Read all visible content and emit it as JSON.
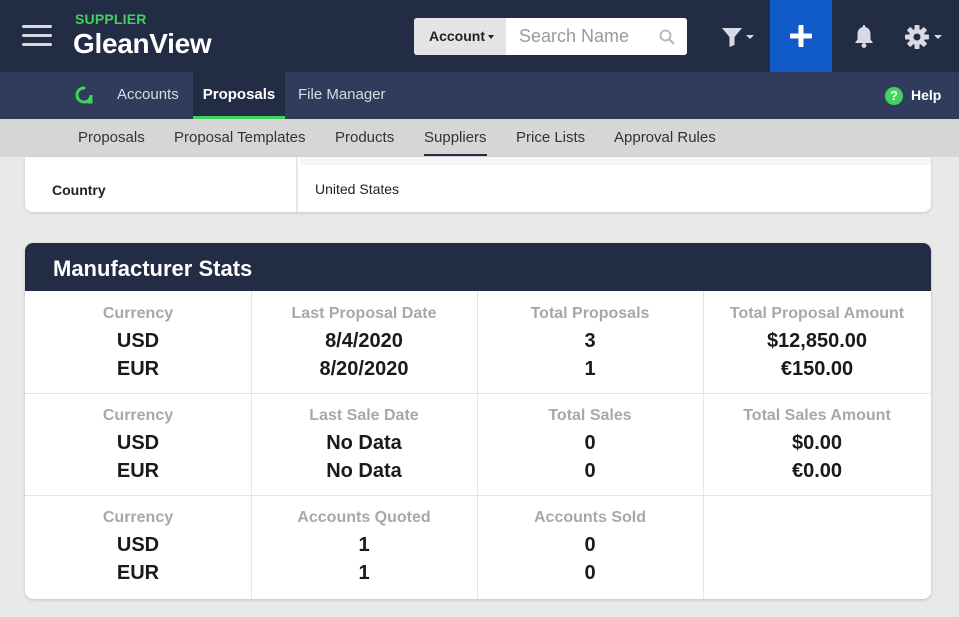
{
  "header": {
    "brand_sub": "SUPPLIER",
    "brand_main": "GleanView",
    "search_type_label": "Account",
    "search_placeholder": "Search Name"
  },
  "nav": {
    "items": [
      {
        "label": "Accounts"
      },
      {
        "label": "Proposals",
        "active": true
      },
      {
        "label": "File Manager"
      }
    ],
    "help_label": "Help"
  },
  "subnav": {
    "items": [
      {
        "label": "Proposals"
      },
      {
        "label": "Proposal Templates"
      },
      {
        "label": "Products"
      },
      {
        "label": "Suppliers",
        "active": true
      },
      {
        "label": "Price Lists"
      },
      {
        "label": "Approval Rules"
      }
    ]
  },
  "country": {
    "label": "Country",
    "value": "United States"
  },
  "stats": {
    "title": "Manufacturer Stats",
    "rows": [
      [
        {
          "label": "Currency",
          "v1": "USD",
          "v2": "EUR"
        },
        {
          "label": "Last Proposal Date",
          "v1": "8/4/2020",
          "v2": "8/20/2020"
        },
        {
          "label": "Total Proposals",
          "v1": "3",
          "v2": "1"
        },
        {
          "label": "Total Proposal Amount",
          "v1": "$12,850.00",
          "v2": "€150.00"
        }
      ],
      [
        {
          "label": "Currency",
          "v1": "USD",
          "v2": "EUR"
        },
        {
          "label": "Last Sale Date",
          "v1": "No Data",
          "v2": "No Data"
        },
        {
          "label": "Total Sales",
          "v1": "0",
          "v2": "0"
        },
        {
          "label": "Total Sales Amount",
          "v1": "$0.00",
          "v2": "€0.00"
        }
      ],
      [
        {
          "label": "Currency",
          "v1": "USD",
          "v2": "EUR"
        },
        {
          "label": "Accounts Quoted",
          "v1": "1",
          "v2": "1"
        },
        {
          "label": "Accounts Sold",
          "v1": "0",
          "v2": "0"
        },
        {
          "label": "",
          "v1": "",
          "v2": ""
        }
      ]
    ]
  },
  "colors": {
    "header_bg": "#232c45",
    "nav_bg": "#313b5c",
    "accent_green": "#3fd25d",
    "add_button_blue": "#0f59c8",
    "subnav_bg": "#d6d6d6"
  },
  "icons": {
    "menu": "hamburger-icon",
    "search": "search-icon",
    "filter": "filter-icon",
    "add": "plus-icon",
    "notifications": "bell-icon",
    "settings": "gear-icon",
    "help": "question-circle-icon",
    "nav_logo": "gleanview-logo-icon"
  }
}
